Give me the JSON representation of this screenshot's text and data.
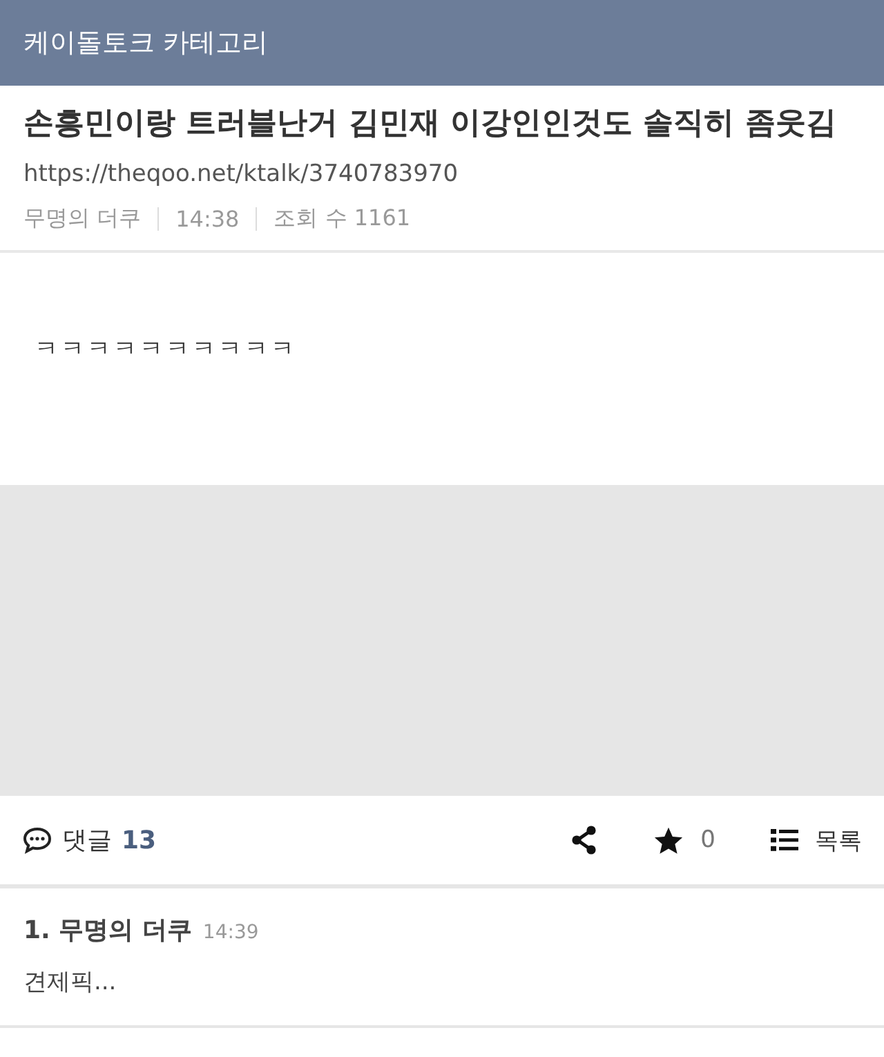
{
  "header": {
    "title": "케이돌토크 카테고리"
  },
  "post": {
    "title": "손흥민이랑 트러블난거 김민재 이강인인것도 솔직히 좀웃김",
    "url": "https://theqoo.net/ktalk/3740783970",
    "author": "무명의 더쿠",
    "time": "14:38",
    "views": "조회 수 1161",
    "body": "ㅋㅋㅋㅋㅋㅋㅋㅋㅋㅋ"
  },
  "actions": {
    "comments_label": "댓글",
    "comments_count": "13",
    "stars": "0",
    "list_label": "목록"
  },
  "comments": [
    {
      "number": "1.",
      "author": "무명의 더쿠",
      "time": "14:39",
      "text": "견제픽..."
    }
  ]
}
